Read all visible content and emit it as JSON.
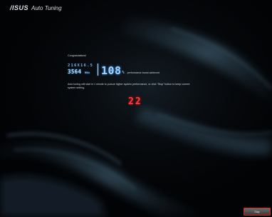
{
  "brand": {
    "logo": "/ISUS",
    "title": "Auto Tuning"
  },
  "result": {
    "congrats": "Congratulations!",
    "freq_top": "216X16.5",
    "freq_main": "3564",
    "freq_unit": "MHz",
    "percent": "108",
    "percent_sign": "%",
    "boost_text": "performance boost achieved"
  },
  "message": "Auto tuning will start in 1 minute to pursue higher system performance, or click \"Stop\" button to keep current system setting.",
  "countdown": "22",
  "stop_button": {
    "label": "Stop"
  },
  "colors": {
    "digits_blue": "#9fd2ff",
    "countdown_red": "#ff3a3a",
    "button_border": "#e02020"
  }
}
